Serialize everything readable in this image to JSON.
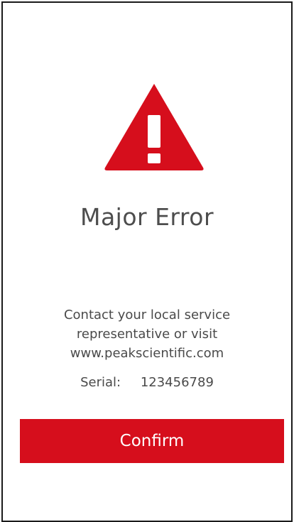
{
  "alert": {
    "icon": "warning-triangle-icon",
    "icon_color": "#d60e1c",
    "title": "Major Error",
    "message_lines": [
      "Contact your local service",
      "representative or visit",
      "www.peakscientific.com"
    ],
    "serial_label": "Serial:",
    "serial_value": "123456789"
  },
  "actions": {
    "confirm_label": "Confirm",
    "confirm_color": "#d60e1c"
  }
}
